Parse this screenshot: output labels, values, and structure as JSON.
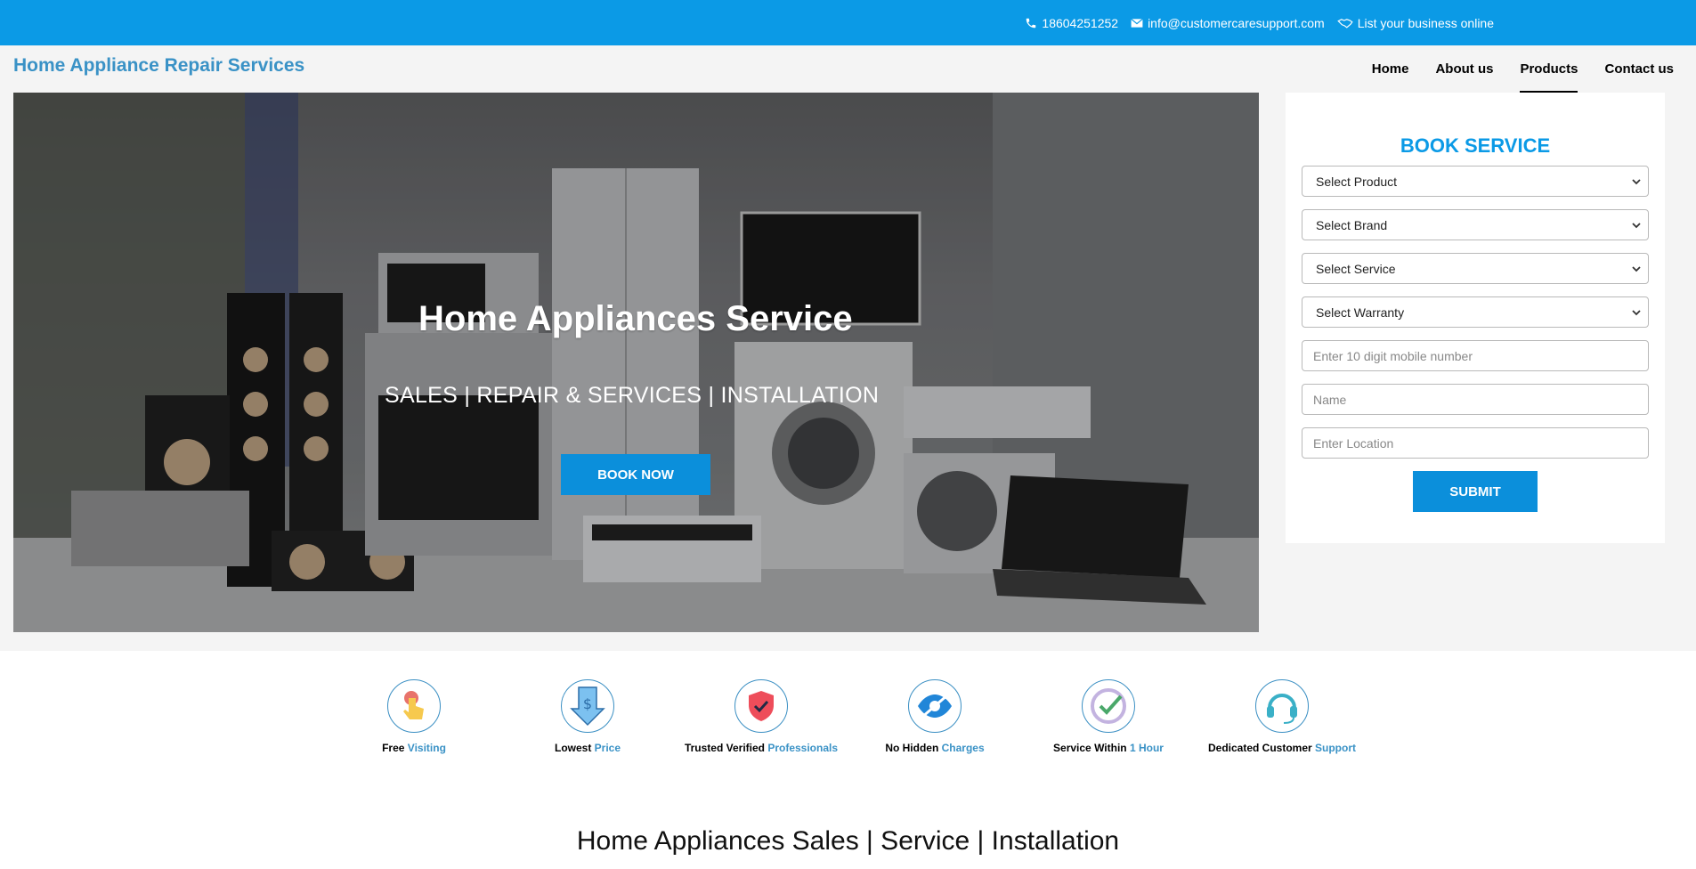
{
  "topbar": {
    "phone": "18604251252",
    "email": "info@customercaresupport.com",
    "list_business": "List your business online"
  },
  "header": {
    "brand": "Home Appliance Repair Services",
    "nav": [
      "Home",
      "About us",
      "Products",
      "Contact us"
    ],
    "active_nav": "Products"
  },
  "hero": {
    "title": "Home Appliances Service",
    "subtitle": "SALES | REPAIR & SERVICES | INSTALLATION",
    "button": "BOOK NOW"
  },
  "booking": {
    "title": "BOOK SERVICE",
    "product": "Select Product",
    "brand": "Select Brand",
    "service": "Select Service",
    "warranty": "Select Warranty",
    "mobile_placeholder": "Enter 10 digit mobile number",
    "name_placeholder": "Name",
    "location_placeholder": "Enter Location",
    "submit": "SUBMIT"
  },
  "features": [
    {
      "plain": "Free ",
      "highlight": "Visiting",
      "icon": "hand-tap-icon"
    },
    {
      "plain": "Lowest ",
      "highlight": "Price",
      "icon": "price-down-icon"
    },
    {
      "plain": "Trusted Verified ",
      "highlight": "Professionals",
      "icon": "shield-check-icon"
    },
    {
      "plain": "No Hidden ",
      "highlight": "Charges",
      "icon": "eye-off-icon"
    },
    {
      "plain": "Service Within ",
      "highlight": "1 Hour",
      "icon": "check-circle-icon"
    },
    {
      "plain": "Dedicated Customer ",
      "highlight": "Support",
      "icon": "headset-icon"
    }
  ],
  "colors": {
    "accent": "#0b9ae6",
    "brand": "#3a92c6",
    "button": "#0b8fdb"
  },
  "section_title": "Home Appliances Sales | Service | Installation"
}
